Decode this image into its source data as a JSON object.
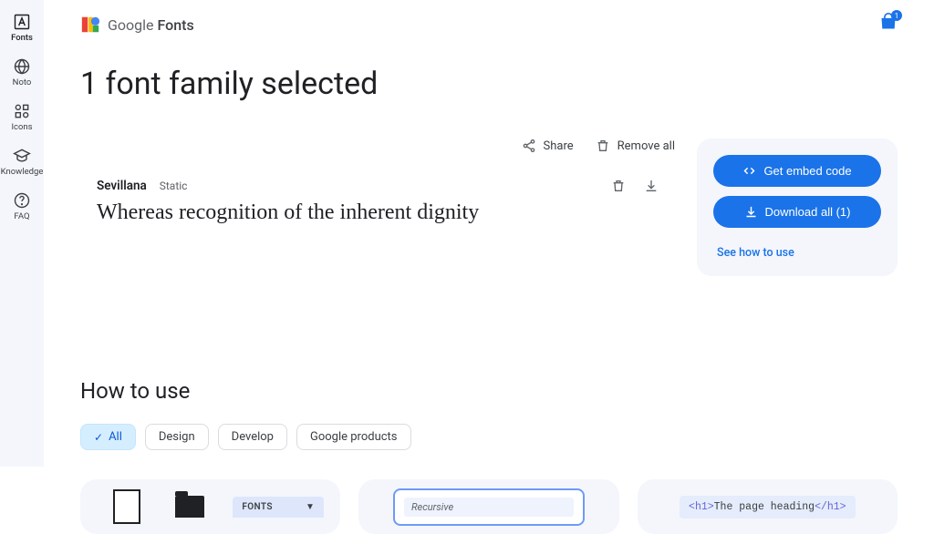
{
  "sidebar": {
    "items": [
      {
        "label": "Fonts"
      },
      {
        "label": "Noto"
      },
      {
        "label": "Icons"
      },
      {
        "label": "Knowledge"
      },
      {
        "label": "FAQ"
      }
    ]
  },
  "header": {
    "brand": "Google",
    "product": "Fonts",
    "bag_count": "1"
  },
  "page": {
    "title": "1 font family selected"
  },
  "actions": {
    "share": "Share",
    "remove_all": "Remove all"
  },
  "font": {
    "name": "Sevillana",
    "type": "Static",
    "preview": "Whereas recognition of the inherent dignity"
  },
  "panel": {
    "embed": "Get embed code",
    "download": "Download all (1)",
    "how_to": "See how to use"
  },
  "howto": {
    "title": "How to use",
    "chips": [
      "All",
      "Design",
      "Develop",
      "Google products"
    ]
  },
  "cards": {
    "dropdown_label": "FONTS",
    "search_text": "Recursive",
    "code_text": "The page heading",
    "code_tag_open": "<h1>",
    "code_tag_close": "</h1>"
  }
}
